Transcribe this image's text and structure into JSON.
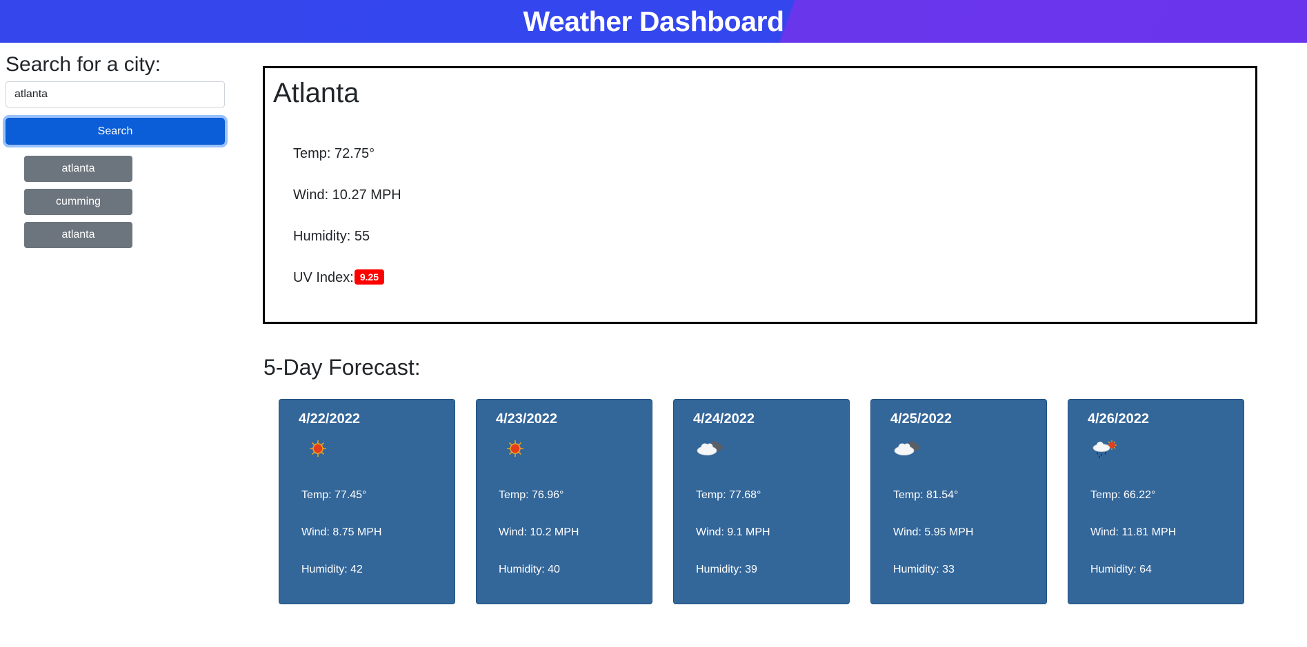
{
  "header": {
    "title": "Weather Dashboard"
  },
  "sidebar": {
    "heading": "Search for a city:",
    "search_value": "atlanta",
    "search_button": "Search",
    "history": [
      "atlanta",
      "cumming",
      "atlanta"
    ]
  },
  "current": {
    "city": "Atlanta",
    "temp": "Temp: 72.75°",
    "wind": "Wind: 10.27 MPH",
    "humidity": "Humidity: 55",
    "uv_label": "UV Index:",
    "uv_value": "9.25",
    "uv_color": "#ff0000"
  },
  "forecast": {
    "heading": "5-Day Forecast:",
    "days": [
      {
        "date": "4/22/2022",
        "icon": "sun-icon",
        "temp": "Temp: 77.45°",
        "wind": "Wind: 8.75 MPH",
        "humidity": "Humidity: 42"
      },
      {
        "date": "4/23/2022",
        "icon": "sun-icon",
        "temp": "Temp: 76.96°",
        "wind": "Wind: 10.2 MPH",
        "humidity": "Humidity: 40"
      },
      {
        "date": "4/24/2022",
        "icon": "clouds-icon",
        "temp": "Temp: 77.68°",
        "wind": "Wind: 9.1 MPH",
        "humidity": "Humidity: 39"
      },
      {
        "date": "4/25/2022",
        "icon": "clouds-icon",
        "temp": "Temp: 81.54°",
        "wind": "Wind: 5.95 MPH",
        "humidity": "Humidity: 33"
      },
      {
        "date": "4/26/2022",
        "icon": "rain-sun-icon",
        "temp": "Temp: 66.22°",
        "wind": "Wind: 11.81 MPH",
        "humidity": "Humidity: 64"
      }
    ]
  },
  "colors": {
    "header_blue": "#3546ec",
    "header_purple": "#6a36ec",
    "search_button": "#0b5ed7",
    "history_button": "#6c757d",
    "forecast_card": "#336699"
  }
}
